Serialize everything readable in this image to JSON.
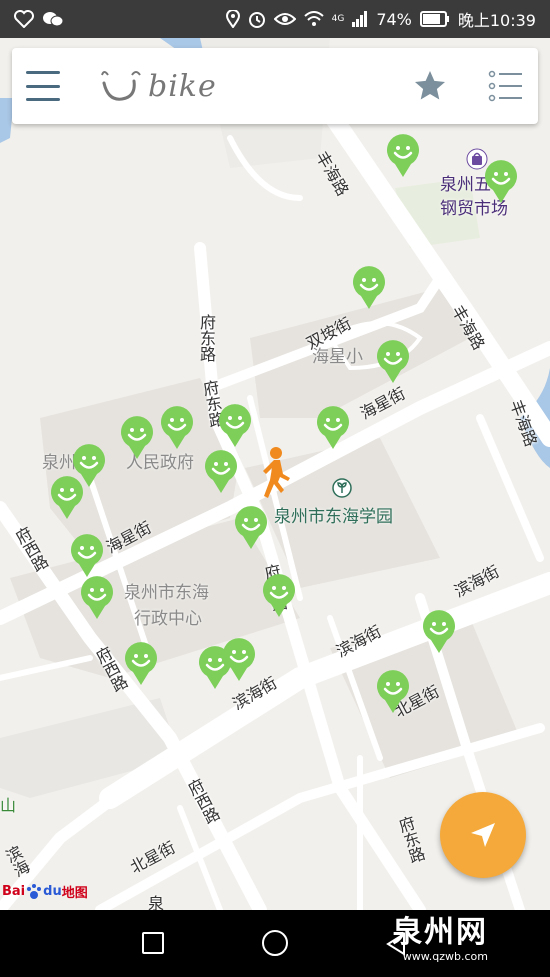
{
  "status_bar": {
    "battery": "74%",
    "time": "晚上10:39",
    "network": "4G"
  },
  "app": {
    "logo_text": "bike"
  },
  "map": {
    "roads": {
      "fenghai_1": "丰海路",
      "fenghai_2": "丰海路",
      "fenghai_3": "丰海路",
      "shuangan": "双垵街",
      "fudong_1": "府东路",
      "fudong_2": "府东路",
      "fudong_3": "府东路",
      "fudong_4": "府东路",
      "haixing_1": "海星街",
      "haixing_2": "海星街",
      "binhai_1": "滨海街",
      "binhai_2": "滨海街",
      "binhai_3": "滨海街",
      "binhai_4": "滨海",
      "fuxi_1": "府西路",
      "fuxi_2": "府西路",
      "fuxi_3": "府西路",
      "beixing_1": "北星街",
      "beixing_2": "北星街",
      "quan_partial": "泉",
      "mountain": "山"
    },
    "pois": {
      "market_line1": "泉州五",
      "market_line2": "钢贸市场",
      "haixing_school": "海星小",
      "gov_part1": "泉州",
      "gov_part2": "人民政府",
      "donghai_school": "泉州市东海学园",
      "admin_center_line1": "泉州市东海",
      "admin_center_line2": "行政中心"
    },
    "bike_count": 20,
    "colors": {
      "bike_marker": "#7dcf5a",
      "user_marker": "#f08a1e",
      "fab": "#f4a93a"
    }
  },
  "baidu": {
    "bai": "Bai",
    "du": "du",
    "map": "地图"
  },
  "watermark": {
    "title": "泉州网",
    "url": "www.qzwb.com"
  }
}
